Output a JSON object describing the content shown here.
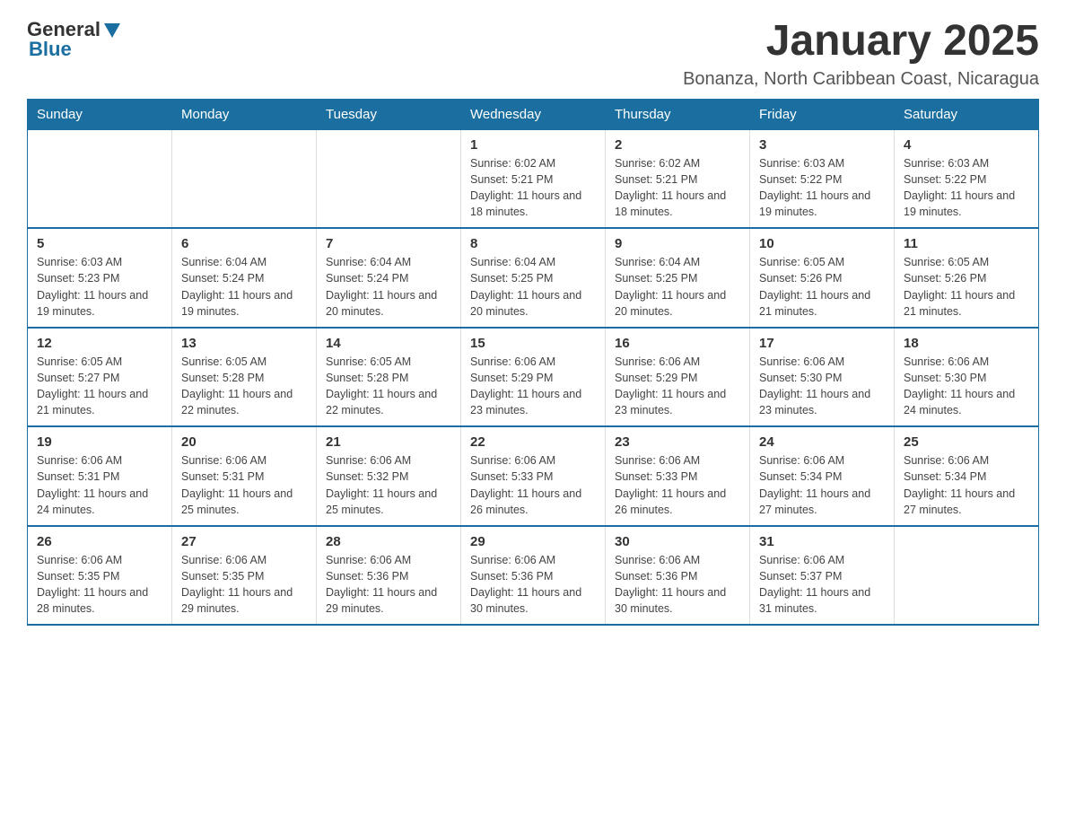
{
  "header": {
    "logo_general": "General",
    "logo_blue": "Blue",
    "month_title": "January 2025",
    "subtitle": "Bonanza, North Caribbean Coast, Nicaragua"
  },
  "days_of_week": [
    "Sunday",
    "Monday",
    "Tuesday",
    "Wednesday",
    "Thursday",
    "Friday",
    "Saturday"
  ],
  "weeks": [
    [
      {
        "day": "",
        "detail": ""
      },
      {
        "day": "",
        "detail": ""
      },
      {
        "day": "",
        "detail": ""
      },
      {
        "day": "1",
        "detail": "Sunrise: 6:02 AM\nSunset: 5:21 PM\nDaylight: 11 hours and 18 minutes."
      },
      {
        "day": "2",
        "detail": "Sunrise: 6:02 AM\nSunset: 5:21 PM\nDaylight: 11 hours and 18 minutes."
      },
      {
        "day": "3",
        "detail": "Sunrise: 6:03 AM\nSunset: 5:22 PM\nDaylight: 11 hours and 19 minutes."
      },
      {
        "day": "4",
        "detail": "Sunrise: 6:03 AM\nSunset: 5:22 PM\nDaylight: 11 hours and 19 minutes."
      }
    ],
    [
      {
        "day": "5",
        "detail": "Sunrise: 6:03 AM\nSunset: 5:23 PM\nDaylight: 11 hours and 19 minutes."
      },
      {
        "day": "6",
        "detail": "Sunrise: 6:04 AM\nSunset: 5:24 PM\nDaylight: 11 hours and 19 minutes."
      },
      {
        "day": "7",
        "detail": "Sunrise: 6:04 AM\nSunset: 5:24 PM\nDaylight: 11 hours and 20 minutes."
      },
      {
        "day": "8",
        "detail": "Sunrise: 6:04 AM\nSunset: 5:25 PM\nDaylight: 11 hours and 20 minutes."
      },
      {
        "day": "9",
        "detail": "Sunrise: 6:04 AM\nSunset: 5:25 PM\nDaylight: 11 hours and 20 minutes."
      },
      {
        "day": "10",
        "detail": "Sunrise: 6:05 AM\nSunset: 5:26 PM\nDaylight: 11 hours and 21 minutes."
      },
      {
        "day": "11",
        "detail": "Sunrise: 6:05 AM\nSunset: 5:26 PM\nDaylight: 11 hours and 21 minutes."
      }
    ],
    [
      {
        "day": "12",
        "detail": "Sunrise: 6:05 AM\nSunset: 5:27 PM\nDaylight: 11 hours and 21 minutes."
      },
      {
        "day": "13",
        "detail": "Sunrise: 6:05 AM\nSunset: 5:28 PM\nDaylight: 11 hours and 22 minutes."
      },
      {
        "day": "14",
        "detail": "Sunrise: 6:05 AM\nSunset: 5:28 PM\nDaylight: 11 hours and 22 minutes."
      },
      {
        "day": "15",
        "detail": "Sunrise: 6:06 AM\nSunset: 5:29 PM\nDaylight: 11 hours and 23 minutes."
      },
      {
        "day": "16",
        "detail": "Sunrise: 6:06 AM\nSunset: 5:29 PM\nDaylight: 11 hours and 23 minutes."
      },
      {
        "day": "17",
        "detail": "Sunrise: 6:06 AM\nSunset: 5:30 PM\nDaylight: 11 hours and 23 minutes."
      },
      {
        "day": "18",
        "detail": "Sunrise: 6:06 AM\nSunset: 5:30 PM\nDaylight: 11 hours and 24 minutes."
      }
    ],
    [
      {
        "day": "19",
        "detail": "Sunrise: 6:06 AM\nSunset: 5:31 PM\nDaylight: 11 hours and 24 minutes."
      },
      {
        "day": "20",
        "detail": "Sunrise: 6:06 AM\nSunset: 5:31 PM\nDaylight: 11 hours and 25 minutes."
      },
      {
        "day": "21",
        "detail": "Sunrise: 6:06 AM\nSunset: 5:32 PM\nDaylight: 11 hours and 25 minutes."
      },
      {
        "day": "22",
        "detail": "Sunrise: 6:06 AM\nSunset: 5:33 PM\nDaylight: 11 hours and 26 minutes."
      },
      {
        "day": "23",
        "detail": "Sunrise: 6:06 AM\nSunset: 5:33 PM\nDaylight: 11 hours and 26 minutes."
      },
      {
        "day": "24",
        "detail": "Sunrise: 6:06 AM\nSunset: 5:34 PM\nDaylight: 11 hours and 27 minutes."
      },
      {
        "day": "25",
        "detail": "Sunrise: 6:06 AM\nSunset: 5:34 PM\nDaylight: 11 hours and 27 minutes."
      }
    ],
    [
      {
        "day": "26",
        "detail": "Sunrise: 6:06 AM\nSunset: 5:35 PM\nDaylight: 11 hours and 28 minutes."
      },
      {
        "day": "27",
        "detail": "Sunrise: 6:06 AM\nSunset: 5:35 PM\nDaylight: 11 hours and 29 minutes."
      },
      {
        "day": "28",
        "detail": "Sunrise: 6:06 AM\nSunset: 5:36 PM\nDaylight: 11 hours and 29 minutes."
      },
      {
        "day": "29",
        "detail": "Sunrise: 6:06 AM\nSunset: 5:36 PM\nDaylight: 11 hours and 30 minutes."
      },
      {
        "day": "30",
        "detail": "Sunrise: 6:06 AM\nSunset: 5:36 PM\nDaylight: 11 hours and 30 minutes."
      },
      {
        "day": "31",
        "detail": "Sunrise: 6:06 AM\nSunset: 5:37 PM\nDaylight: 11 hours and 31 minutes."
      },
      {
        "day": "",
        "detail": ""
      }
    ]
  ]
}
